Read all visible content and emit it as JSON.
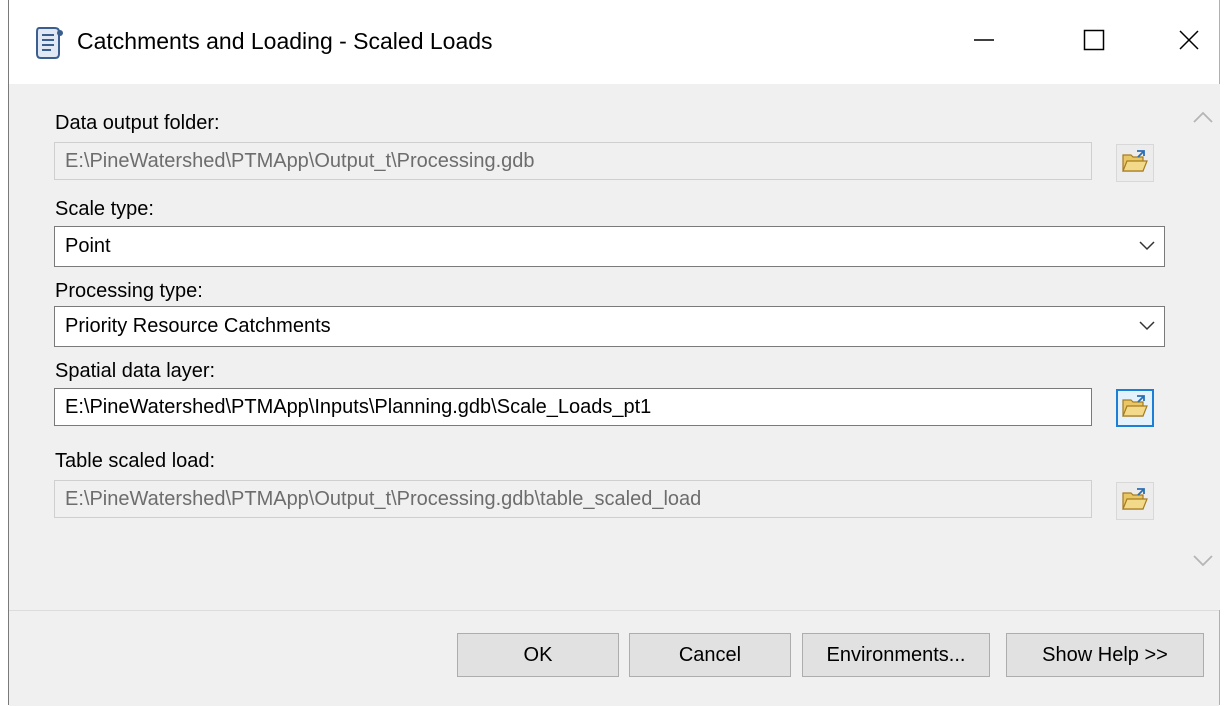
{
  "window": {
    "title": "Catchments and Loading - Scaled Loads",
    "app_icon": "script-tool-icon",
    "controls": {
      "minimize": "minimize-icon",
      "maximize": "maximize-icon",
      "close": "close-icon"
    }
  },
  "form": {
    "data_output_folder": {
      "label": "Data output folder:",
      "value": "E:\\PineWatershed\\PTMApp\\Output_t\\Processing.gdb"
    },
    "scale_type": {
      "label": "Scale type:",
      "value": "Point"
    },
    "processing_type": {
      "label": "Processing type:",
      "value": "Priority Resource Catchments"
    },
    "spatial_data_layer": {
      "label": "Spatial data layer:",
      "value": "E:\\PineWatershed\\PTMApp\\Inputs\\Planning.gdb\\Scale_Loads_pt1"
    },
    "table_scaled_load": {
      "label": "Table scaled load:",
      "value": "E:\\PineWatershed\\PTMApp\\Output_t\\Processing.gdb\\table_scaled_load"
    }
  },
  "buttons": {
    "ok": "OK",
    "cancel": "Cancel",
    "environments": "Environments...",
    "show_help": "Show Help >>"
  },
  "colors": {
    "focus_accent": "#1c7fd6",
    "disabled_text": "#6d6d6d",
    "folder_yellow": "#f1d27a"
  }
}
